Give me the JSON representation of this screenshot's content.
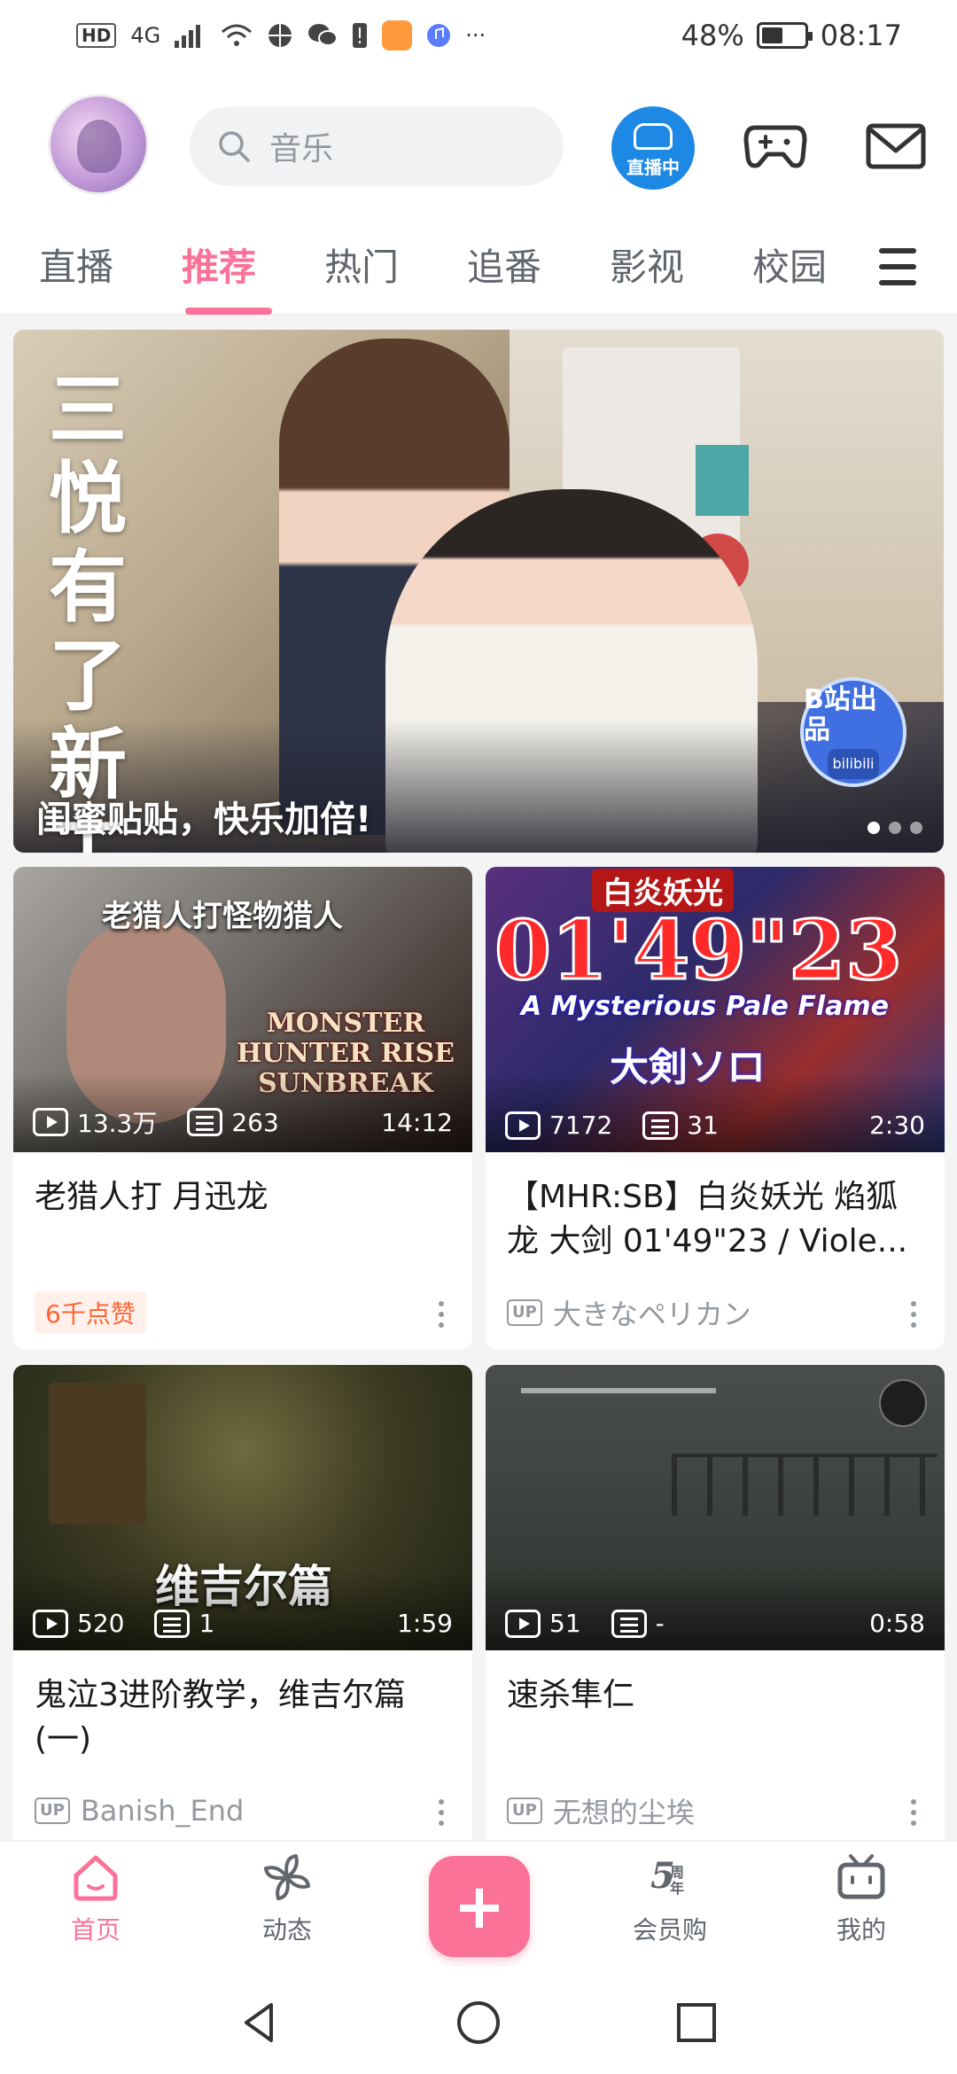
{
  "status_bar": {
    "left_chips": [
      "HD",
      "4G"
    ],
    "battery": "48%",
    "time": "08:17",
    "more": "···"
  },
  "header": {
    "search_placeholder": "音乐",
    "live_label": "直播中"
  },
  "tabs": [
    {
      "label": "直播"
    },
    {
      "label": "推荐"
    },
    {
      "label": "热门"
    },
    {
      "label": "追番"
    },
    {
      "label": "影视"
    },
    {
      "label": "校园"
    }
  ],
  "banner": {
    "calligraphy": "三悦有了新工作",
    "caption": "闺蜜贴贴，快乐加倍!",
    "badge_main": "B站出品",
    "badge_sub": "bilibili",
    "dots_total": 3,
    "dots_active": 1
  },
  "cards": [
    {
      "thumb_text": "老猎人打怪物猎人",
      "thumb_logo": "MONSTER HUNTER RISE SUNBREAK",
      "plays": "13.3万",
      "danmaku": "263",
      "duration": "14:12",
      "title": "老猎人打  月迅龙",
      "likes": "6千点赞"
    },
    {
      "thumb_top": "白炎妖光",
      "thumb_big": "01'49\"23",
      "thumb_mid": "A Mysterious Pale Flame",
      "thumb_sub": "大剣ソロ",
      "plays": "7172",
      "danmaku": "31",
      "duration": "2:30",
      "title": "【MHR:SB】白炎妖光 焰狐龙 大剑 01'49\"23 /  Viole...",
      "up_label": "UP",
      "uploader": "大きなペリカン"
    },
    {
      "thumb_text": "维吉尔篇",
      "plays": "520",
      "danmaku": "1",
      "duration": "1:59",
      "title": "鬼泣3进阶教学，维吉尔篇(一)",
      "up_label": "UP",
      "uploader": "Banish_End"
    },
    {
      "plays": "51",
      "danmaku": "-",
      "duration": "0:58",
      "title": "速杀隼仁",
      "up_label": "UP",
      "uploader": "无想的尘埃"
    }
  ],
  "bottom_nav": [
    {
      "label": "首页",
      "icon": "home-icon",
      "active": true
    },
    {
      "label": "动态",
      "icon": "pinwheel-icon"
    },
    {
      "label": "+",
      "icon": "plus-icon"
    },
    {
      "label": "会员购",
      "icon": "5th-anniversary-icon"
    },
    {
      "label": "我的",
      "icon": "tv-icon"
    }
  ],
  "colors": {
    "accent": "#fb7299",
    "likes": "#ff6633",
    "muted": "#9499a0"
  }
}
